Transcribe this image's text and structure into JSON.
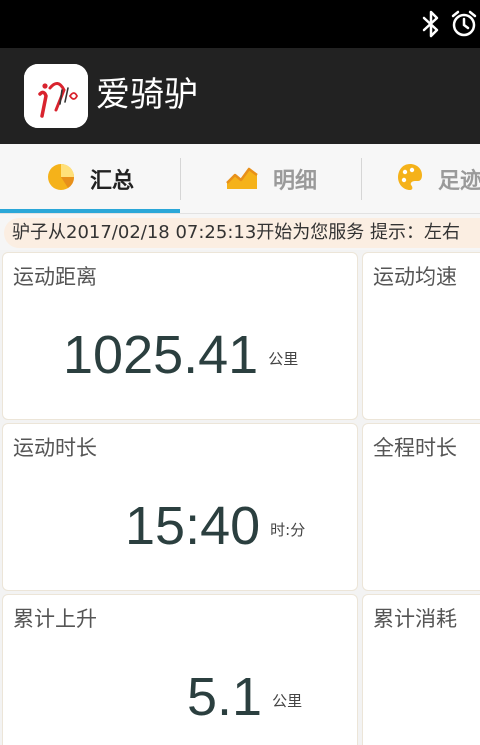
{
  "app": {
    "title": "爱骑驴",
    "logo_icon": "app-logo"
  },
  "status_bar": {
    "icons": [
      "bluetooth-icon",
      "alarm-icon"
    ]
  },
  "tabs": [
    {
      "label": "汇总",
      "icon": "pie-chart-icon",
      "active": true
    },
    {
      "label": "明细",
      "icon": "area-chart-icon",
      "active": false
    },
    {
      "label": "足迹",
      "icon": "palette-icon",
      "active": false
    }
  ],
  "ticker": {
    "text": "驴子从2017/02/18 07:25:13开始为您服务 提示：左右"
  },
  "stats": [
    {
      "title": "运动距离",
      "value": "1025.41",
      "unit": "公里"
    },
    {
      "title": "运动均速",
      "value": "",
      "unit": ""
    },
    {
      "title": "运动时长",
      "value": "15:40",
      "unit": "时:分"
    },
    {
      "title": "全程时长",
      "value": "",
      "unit": ""
    },
    {
      "title": "累计上升",
      "value": "5.1",
      "unit": "公里"
    },
    {
      "title": "累计消耗",
      "value": "",
      "unit": ""
    }
  ],
  "colors": {
    "accent": "#2aa7d8",
    "value_text": "#2b3f3f",
    "ticker_bg": "#fbeee2",
    "action_bar": "#222222"
  }
}
